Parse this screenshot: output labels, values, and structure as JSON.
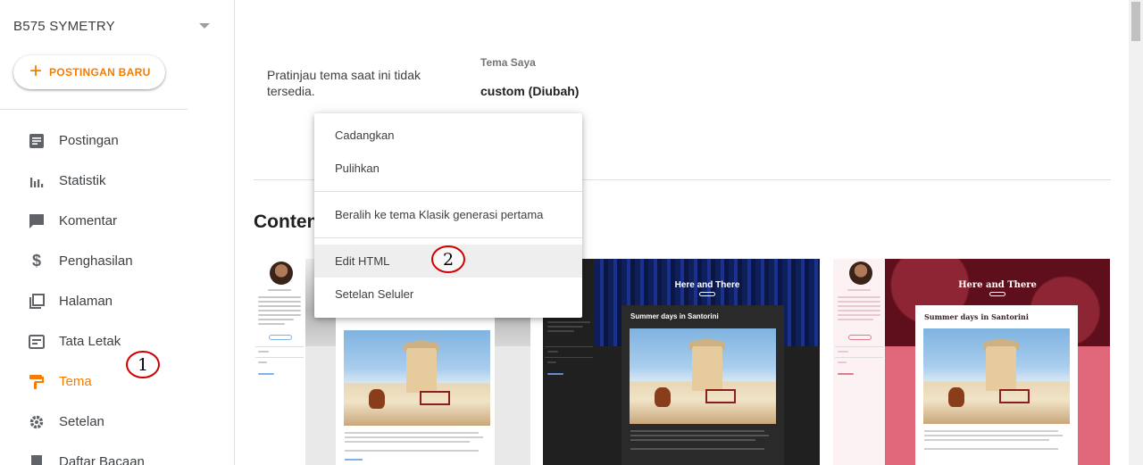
{
  "sidebar": {
    "blog_name": "B575 SYMETRY",
    "new_post_label": "POSTINGAN BARU",
    "items": [
      {
        "label": "Postingan",
        "icon": "posts-icon"
      },
      {
        "label": "Statistik",
        "icon": "stats-icon"
      },
      {
        "label": "Komentar",
        "icon": "comment-icon"
      },
      {
        "label": "Penghasilan",
        "icon": "dollar-icon"
      },
      {
        "label": "Halaman",
        "icon": "pages-icon"
      },
      {
        "label": "Tata Letak",
        "icon": "layout-icon"
      },
      {
        "label": "Tema",
        "icon": "paint-roller-icon",
        "active": true
      },
      {
        "label": "Setelan",
        "icon": "gear-icon"
      },
      {
        "label": "Daftar Bacaan",
        "icon": "bookmark-icon"
      }
    ]
  },
  "main": {
    "preview_unavailable": "Pratinjau tema saat ini tidak tersedia.",
    "my_theme_label": "Tema Saya",
    "my_theme_name": "custom (Diubah)",
    "section_title": "Conten",
    "cards": [
      {
        "banner_title": "",
        "post_title": ""
      },
      {
        "banner_title": "Here and There",
        "post_title": "Summer days in Santorini"
      },
      {
        "banner_title": "Here and There",
        "post_title": "Summer days in Santorini"
      }
    ]
  },
  "menu": {
    "items": [
      "Cadangkan",
      "Pulihkan",
      "Beralih ke tema Klasik generasi pertama",
      "Edit HTML",
      "Setelan Seluler"
    ],
    "highlighted_index": 3
  },
  "annotations": {
    "marker1": "1",
    "marker2": "2"
  },
  "colors": {
    "accent": "#f57c00",
    "annotation_ring": "#d00000"
  }
}
